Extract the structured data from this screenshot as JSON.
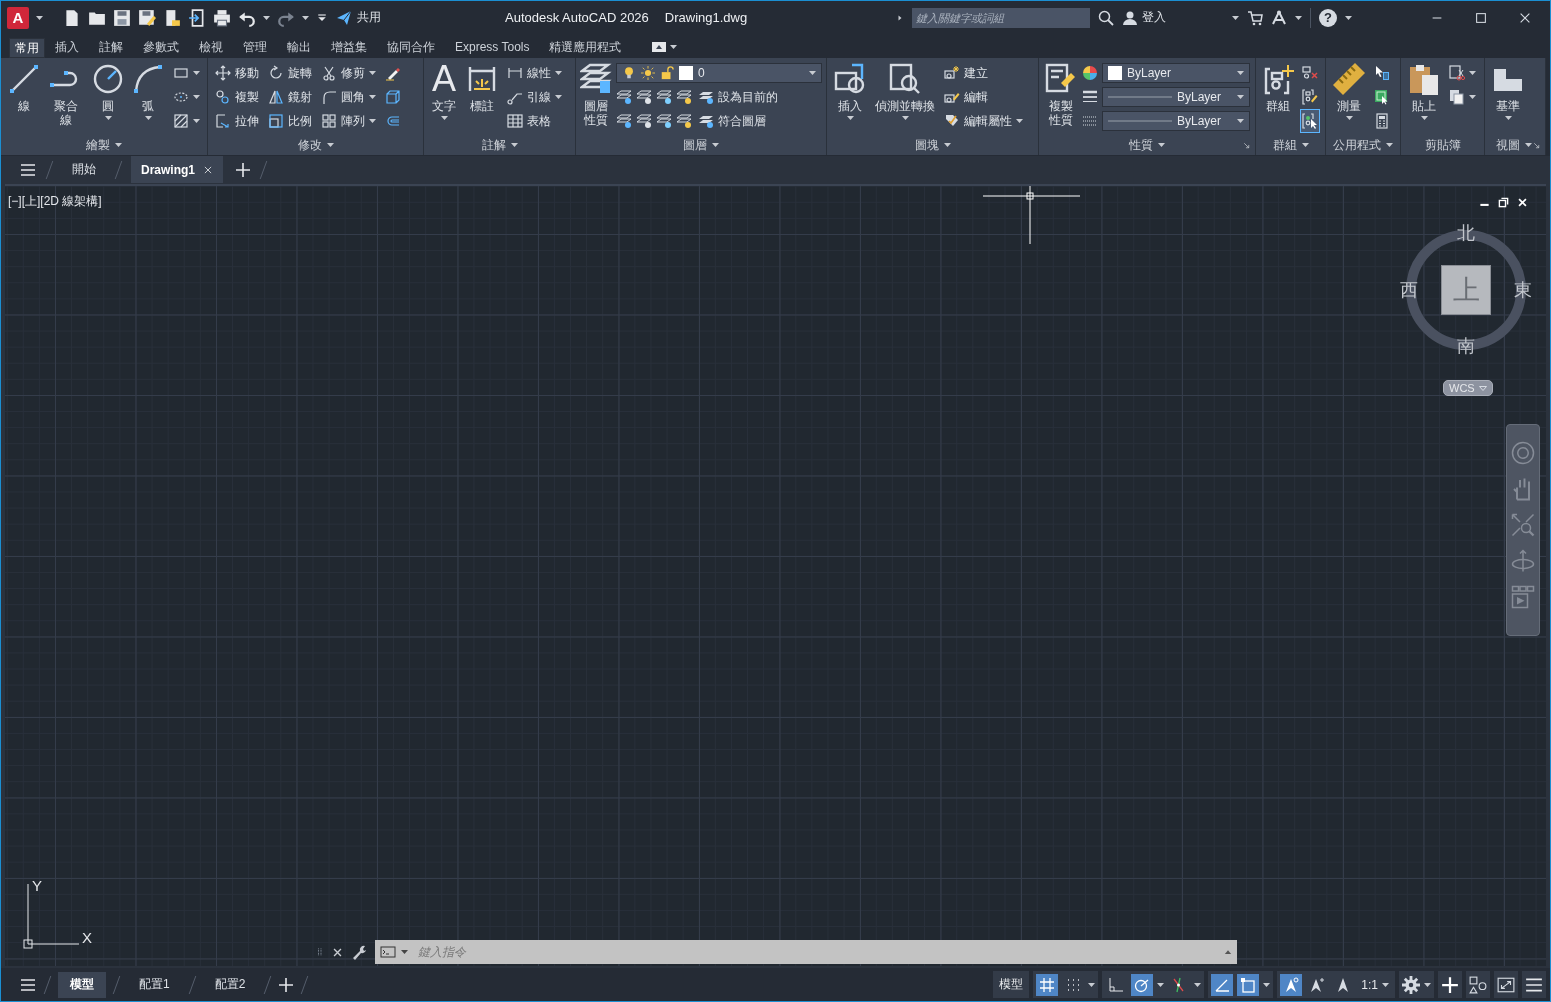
{
  "title_bar": {
    "app_button": "A",
    "share_label": "共用",
    "app_title": "Autodesk AutoCAD 2026",
    "file_name": "Drawing1.dwg",
    "search": {
      "placeholder": "鍵入關鍵字或詞組"
    },
    "sign_in": "登入",
    "help": "?"
  },
  "ribbon": {
    "tabs": [
      {
        "label": "常用",
        "selected": true
      },
      {
        "label": "插入",
        "selected": false
      },
      {
        "label": "註解",
        "selected": false
      },
      {
        "label": "參數式",
        "selected": false
      },
      {
        "label": "檢視",
        "selected": false
      },
      {
        "label": "管理",
        "selected": false
      },
      {
        "label": "輸出",
        "selected": false
      },
      {
        "label": "增益集",
        "selected": false
      },
      {
        "label": "協同合作",
        "selected": false
      },
      {
        "label": "Express Tools",
        "selected": false
      },
      {
        "label": "精選應用程式",
        "selected": false
      }
    ],
    "panels": [
      {
        "title": "繪製",
        "menu": true,
        "launcher": false,
        "tools": [
          {
            "kind": "large",
            "label": "線",
            "dropdown": false
          },
          {
            "kind": "large",
            "label": "聚合線",
            "dropdown": false
          },
          {
            "kind": "large",
            "label": "圓",
            "dropdown": true
          },
          {
            "kind": "large",
            "label": "弧",
            "dropdown": true
          },
          {
            "kind": "stack",
            "items": [
              {
                "kind": "tool",
                "dropdown": true
              },
              {
                "kind": "tool",
                "dropdown": true
              },
              {
                "kind": "tool",
                "dropdown": true
              }
            ]
          }
        ]
      },
      {
        "title": "修改",
        "menu": true,
        "launcher": false,
        "tools": [
          {
            "kind": "stack",
            "items": [
              {
                "kind": "tool",
                "label": "移動",
                "dropdown": false
              },
              {
                "kind": "tool",
                "label": "複製",
                "dropdown": false
              },
              {
                "kind": "tool",
                "label": "拉伸",
                "dropdown": false
              }
            ]
          },
          {
            "kind": "stack",
            "items": [
              {
                "kind": "tool",
                "label": "旋轉",
                "dropdown": false
              },
              {
                "kind": "tool",
                "label": "鏡射",
                "dropdown": false
              },
              {
                "kind": "tool",
                "label": "比例",
                "dropdown": false
              }
            ]
          },
          {
            "kind": "stack",
            "items": [
              {
                "kind": "tool",
                "label": "修剪",
                "dropdown": true
              },
              {
                "kind": "tool",
                "label": "圓角",
                "dropdown": true
              },
              {
                "kind": "tool",
                "label": "陣列",
                "dropdown": true
              }
            ]
          },
          {
            "kind": "stack",
            "items": [
              {
                "kind": "tool",
                "dropdown": false
              },
              {
                "kind": "tool",
                "dropdown": false
              },
              {
                "kind": "tool",
                "dropdown": false
              }
            ]
          }
        ]
      },
      {
        "title": "註解",
        "menu": true,
        "launcher": false,
        "tools": [
          {
            "kind": "large",
            "glyph": "A",
            "label": "文字",
            "dropdown": true
          },
          {
            "kind": "large",
            "label": "標註",
            "dropdown": false
          },
          {
            "kind": "stack",
            "items": [
              {
                "kind": "tool",
                "label": "線性",
                "dropdown": true
              },
              {
                "kind": "tool",
                "label": "引線",
                "dropdown": true
              },
              {
                "kind": "tool",
                "label": "表格",
                "dropdown": false
              }
            ]
          }
        ]
      },
      {
        "title": "圖層",
        "menu": true,
        "launcher": false,
        "tools": [
          {
            "kind": "large",
            "label": "圖層性質",
            "dropdown": false
          },
          {
            "kind": "stack",
            "items": [
              {
                "kind": "layer-select",
                "value": "0"
              },
              {
                "kind": "layer-tool",
                "label": "設為目前的"
              },
              {
                "kind": "layer-tool",
                "label": "符合圖層"
              }
            ]
          }
        ]
      },
      {
        "title": "圖塊",
        "menu": true,
        "launcher": false,
        "tools": [
          {
            "kind": "large",
            "label": "插入",
            "dropdown": true
          },
          {
            "kind": "large",
            "label": "偵測並轉換",
            "dropdown": true
          },
          {
            "kind": "stack",
            "items": [
              {
                "kind": "tool",
                "label": "建立",
                "dropdown": false
              },
              {
                "kind": "tool",
                "label": "編輯",
                "dropdown": false
              },
              {
                "kind": "tool",
                "label": "編輯屬性",
                "dropdown": true
              }
            ]
          }
        ]
      },
      {
        "title": "性質",
        "menu": true,
        "launcher": true,
        "tools": [
          {
            "kind": "large",
            "label": "複製性質",
            "dropdown": false
          },
          {
            "kind": "stack",
            "items": [
              {
                "kind": "color-select",
                "value": "ByLayer"
              },
              {
                "kind": "line-select",
                "value": "ByLayer"
              },
              {
                "kind": "line-select",
                "value": "ByLayer"
              }
            ]
          }
        ]
      },
      {
        "title": "群組",
        "menu": true,
        "launcher": false,
        "tools": [
          {
            "kind": "large",
            "label": "群組",
            "dropdown": false
          },
          {
            "kind": "stack",
            "items": [
              {
                "kind": "tool",
                "dropdown": false,
                "on": false
              },
              {
                "kind": "tool",
                "dropdown": false,
                "on": false
              },
              {
                "kind": "tool",
                "dropdown": false,
                "on": true
              }
            ]
          }
        ]
      },
      {
        "title": "公用程式",
        "menu": true,
        "launcher": false,
        "tools": [
          {
            "kind": "large",
            "label": "測量",
            "dropdown": true
          },
          {
            "kind": "stack",
            "items": [
              {
                "kind": "tool",
                "dropdown": false
              },
              {
                "kind": "tool",
                "dropdown": false
              },
              {
                "kind": "tool",
                "dropdown": false
              }
            ]
          }
        ]
      },
      {
        "title": "剪貼簿",
        "menu": false,
        "launcher": false,
        "tools": [
          {
            "kind": "large",
            "label": "貼上",
            "dropdown": true
          },
          {
            "kind": "stack",
            "items": [
              {
                "kind": "tool",
                "dropdown": true
              },
              {
                "kind": "tool",
                "dropdown": true
              }
            ]
          }
        ]
      },
      {
        "title": "視圖",
        "menu": true,
        "launcher": true,
        "tools": [
          {
            "kind": "large",
            "label": "基準",
            "dropdown": true
          }
        ]
      }
    ]
  },
  "document_tabs": [
    {
      "label": "開始",
      "selected": false,
      "closable": false
    },
    {
      "label": "Drawing1",
      "selected": true,
      "closable": true
    }
  ],
  "viewport": {
    "label": "[−][上][2D 線架構]",
    "view_cube": {
      "north": "北",
      "west": "西",
      "east": "東",
      "south": "南",
      "face": "上",
      "ucs_menu": "WCS"
    },
    "ucs_icon": {
      "y_axis": "Y",
      "x_axis": "X"
    },
    "command_line": {
      "placeholder": "鍵入指令"
    }
  },
  "layout_tabs": [
    {
      "label": "模型",
      "selected": true
    },
    {
      "label": "配置1",
      "selected": false
    },
    {
      "label": "配置2",
      "selected": false
    }
  ],
  "status_bar": {
    "model_button": "模型",
    "toggles": [
      {
        "on": true
      },
      {
        "on": false
      },
      {
        "on": false
      },
      {
        "on": true
      },
      {
        "on": false
      },
      {
        "on": true
      },
      {
        "on": true
      },
      {
        "on": true
      },
      {
        "on": false
      },
      {
        "on": false
      }
    ],
    "annotation_scale": "1:1"
  }
}
